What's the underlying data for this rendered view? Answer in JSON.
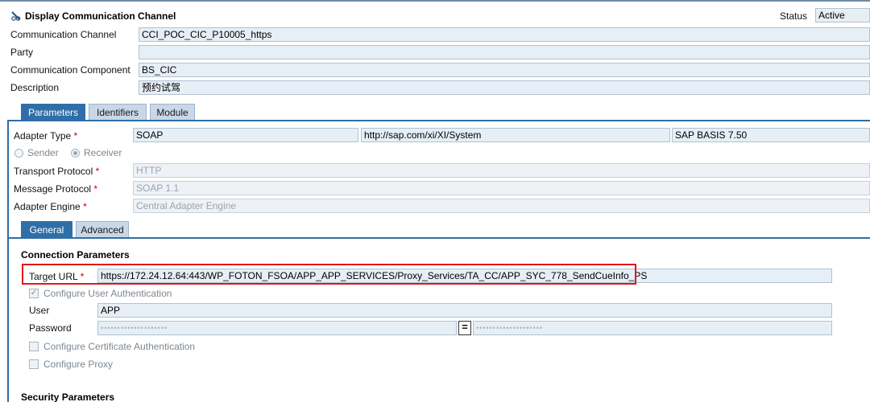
{
  "header": {
    "title": "Display Communication Channel",
    "status_label": "Status",
    "status_value": "Active"
  },
  "channel": {
    "communication_channel_label": "Communication Channel",
    "communication_channel_value": "CCI_POC_CIC_P10005_https",
    "party_label": "Party",
    "party_value": "",
    "component_label": "Communication Component",
    "component_value": "BS_CIC",
    "description_label": "Description",
    "description_value": "预约试驾"
  },
  "tabs": {
    "parameters": "Parameters",
    "identifiers": "Identifiers",
    "module": "Module"
  },
  "parameters": {
    "adapter_type_label": "Adapter Type",
    "adapter_type_value": "SOAP",
    "adapter_namespace": "http://sap.com/xi/XI/System",
    "adapter_swcv": "SAP BASIS 7.50",
    "sender_label": "Sender",
    "receiver_label": "Receiver",
    "transport_protocol_label": "Transport Protocol",
    "transport_protocol_value": "HTTP",
    "message_protocol_label": "Message Protocol",
    "message_protocol_value": "SOAP 1.1",
    "adapter_engine_label": "Adapter Engine",
    "adapter_engine_value": "Central Adapter Engine",
    "required_marker": "*"
  },
  "subtabs": {
    "general": "General",
    "advanced": "Advanced"
  },
  "connection": {
    "heading": "Connection Parameters",
    "target_url_label": "Target URL",
    "target_url_value": "https://172.24.12.64:443/WP_FOTON_FSOA/APP_APP_SERVICES/Proxy_Services/TA_CC/APP_SYC_778_SendCueInfo_PS",
    "configure_user_auth_label": "Configure User Authentication",
    "user_label": "User",
    "user_value": "APP",
    "password_label": "Password",
    "password_masked": "••••••••••••••••••••",
    "password_confirm_masked": "••••••••••••••••••••",
    "equals_symbol": "=",
    "configure_cert_auth_label": "Configure Certificate Authentication",
    "configure_proxy_label": "Configure Proxy",
    "checkmark": "✓"
  },
  "security": {
    "heading": "Security Parameters"
  },
  "colors": {
    "accent": "#2f6ea6",
    "field_bg": "#e6eef6",
    "highlight": "#e01818",
    "required": "#c00000"
  }
}
